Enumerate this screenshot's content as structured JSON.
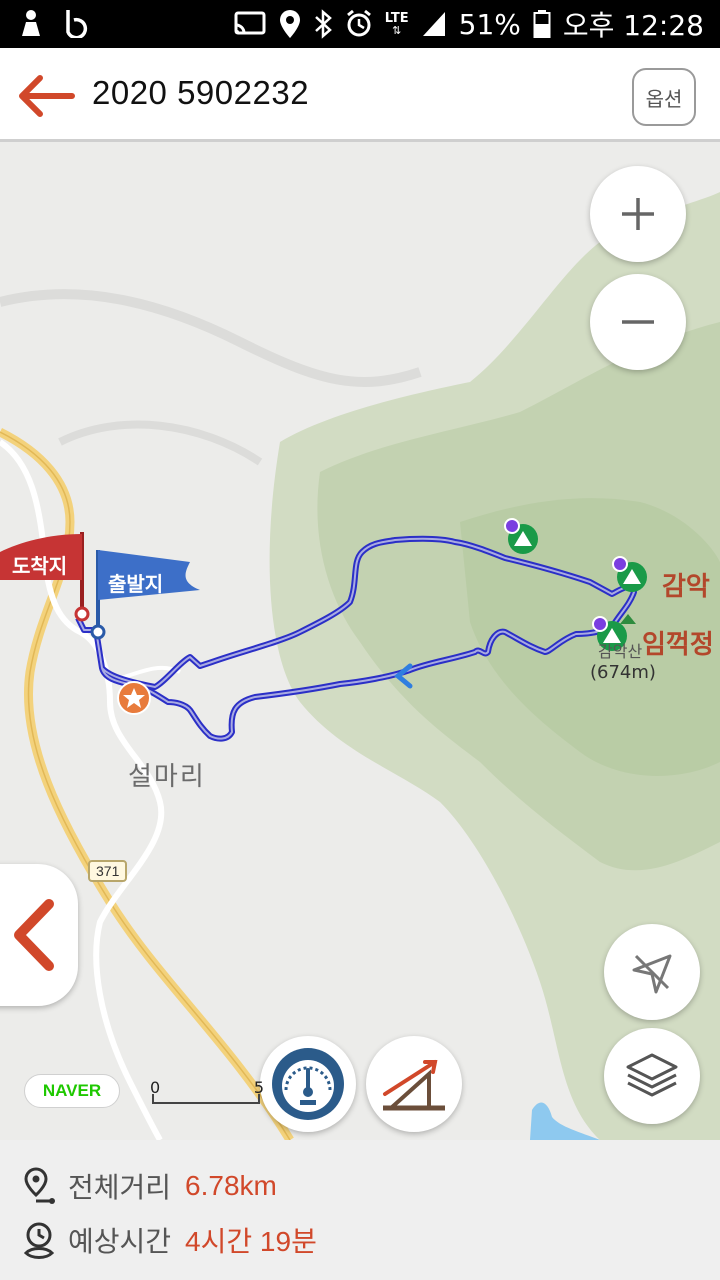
{
  "status_bar": {
    "network": "LTE",
    "battery": "51%",
    "time": "오후 12:28",
    "icons": [
      "person-icon",
      "b-icon",
      "cast-icon",
      "location-icon",
      "bluetooth-icon",
      "alarm-icon",
      "signal-icon",
      "battery-icon"
    ]
  },
  "header": {
    "title": "2020 5902232",
    "option_label": "옵션",
    "back_icon": "back-arrow-icon"
  },
  "map": {
    "arrival_flag": "도착지",
    "departure_flag": "출발지",
    "place_name": "설마리",
    "road_number": "371",
    "peak_main": "감악",
    "peak_second": "임꺽정",
    "peak_label_partial": "감악산",
    "peak_elevation": "(674m)",
    "naver_logo": "NAVER",
    "scale_start": "0",
    "scale_end": "5",
    "colors": {
      "route": "#2b2fc7",
      "accent": "#d1482a",
      "forest": "#c8d8b7"
    }
  },
  "controls": {
    "zoom_in": "zoom-in-icon",
    "zoom_out": "zoom-out-icon",
    "compass": "compass-off-icon",
    "layers": "layers-icon",
    "speedometer": "speedometer-icon",
    "elevation": "elevation-chart-icon",
    "side_collapse": "chevron-left-icon"
  },
  "summary": {
    "distance_label": "전체거리",
    "distance_value": "6.78km",
    "time_label": "예상시간",
    "time_value": "4시간 19분"
  }
}
